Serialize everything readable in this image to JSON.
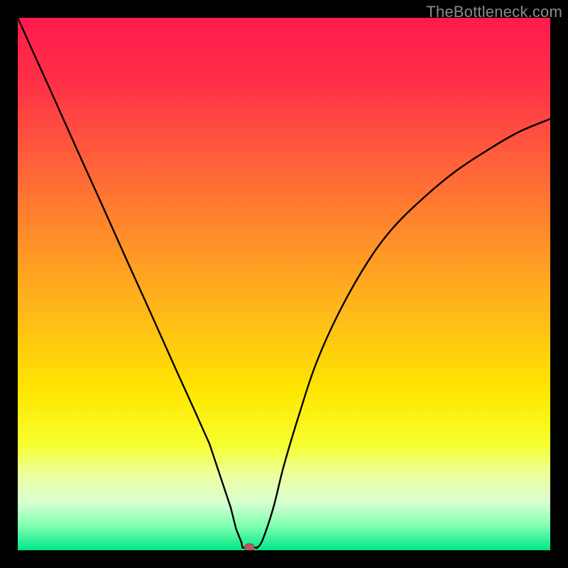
{
  "watermark": "TheBottleneck.com",
  "colors": {
    "frame": "#000000",
    "gradient_stops": [
      {
        "offset": 0.0,
        "color": "#ff1a4d"
      },
      {
        "offset": 0.12,
        "color": "#ff3047"
      },
      {
        "offset": 0.25,
        "color": "#ff5a3c"
      },
      {
        "offset": 0.4,
        "color": "#ff8a2a"
      },
      {
        "offset": 0.55,
        "color": "#ffb81a"
      },
      {
        "offset": 0.7,
        "color": "#ffe600"
      },
      {
        "offset": 0.8,
        "color": "#f6ff2e"
      },
      {
        "offset": 0.86,
        "color": "#ecffa0"
      },
      {
        "offset": 0.91,
        "color": "#d8ffd0"
      },
      {
        "offset": 0.955,
        "color": "#7dffb0"
      },
      {
        "offset": 1.0,
        "color": "#00e688"
      }
    ],
    "curve": "#000000",
    "marker_fill": "#b85a5a",
    "marker_stroke": "#8f4040"
  },
  "chart_data": {
    "type": "line",
    "title": "",
    "xlabel": "",
    "ylabel": "",
    "xlim": [
      0,
      100
    ],
    "ylim": [
      0,
      100
    ],
    "series": [
      {
        "name": "bottleneck-curve",
        "x": [
          0,
          3,
          6,
          9,
          12,
          15,
          18,
          21,
          24,
          27,
          30,
          33,
          36,
          38,
          40,
          41,
          42,
          43,
          44,
          45,
          46,
          48,
          50,
          53,
          56,
          60,
          65,
          70,
          76,
          82,
          88,
          94,
          100
        ],
        "y": [
          100,
          93.3,
          86.7,
          80,
          73.3,
          66.7,
          60,
          53.3,
          46.7,
          40,
          33.3,
          26.7,
          20,
          14,
          8,
          4,
          1.5,
          0.5,
          0.5,
          0.5,
          2,
          8,
          16,
          26,
          35,
          44,
          53,
          60,
          66,
          71,
          75,
          78.5,
          81
        ]
      }
    ],
    "marker": {
      "x": 43.5,
      "y": 0.5
    },
    "flat_bottom": {
      "x1": 42.2,
      "x2": 45.0,
      "y": 0.5
    }
  }
}
